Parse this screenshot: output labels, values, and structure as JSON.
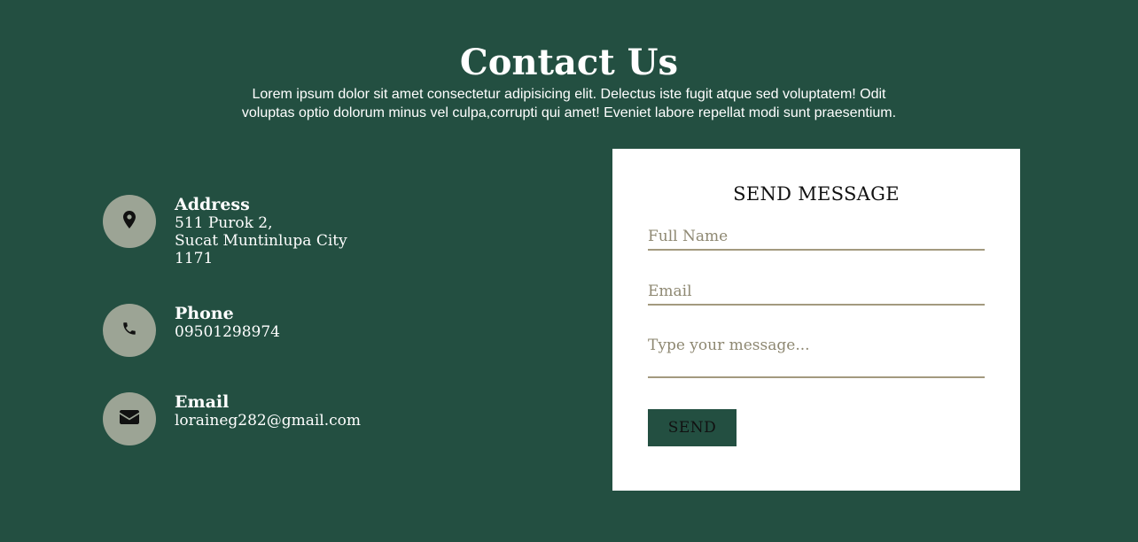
{
  "header": {
    "title": "Contact Us",
    "description_line1": "Lorem ipsum dolor sit amet consectetur adipisicing elit. Delectus iste fugit atque sed voluptatem! Odit",
    "description_line2": "voluptas optio dolorum minus vel culpa,corrupti qui amet! Eveniet labore repellat modi sunt praesentium."
  },
  "contact_info": {
    "address": {
      "icon": "map-pin-icon",
      "title": "Address",
      "line1": "511 Purok 2,",
      "line2": "Sucat Muntinlupa City",
      "line3": "1171"
    },
    "phone": {
      "icon": "phone-icon",
      "title": "Phone",
      "value": "09501298974"
    },
    "email": {
      "icon": "envelope-icon",
      "title": "Email",
      "value": "loraineg282@gmail.com"
    }
  },
  "form": {
    "title": "SEND MESSAGE",
    "full_name_placeholder": "Full Name",
    "email_placeholder": "Email",
    "message_placeholder": "Type your message...",
    "send_label": "SEND"
  },
  "colors": {
    "background": "#234f41",
    "icon_circle": "#9ca495",
    "card": "#ffffff",
    "field_underline": "#a39a7f",
    "button": "#234f41"
  }
}
